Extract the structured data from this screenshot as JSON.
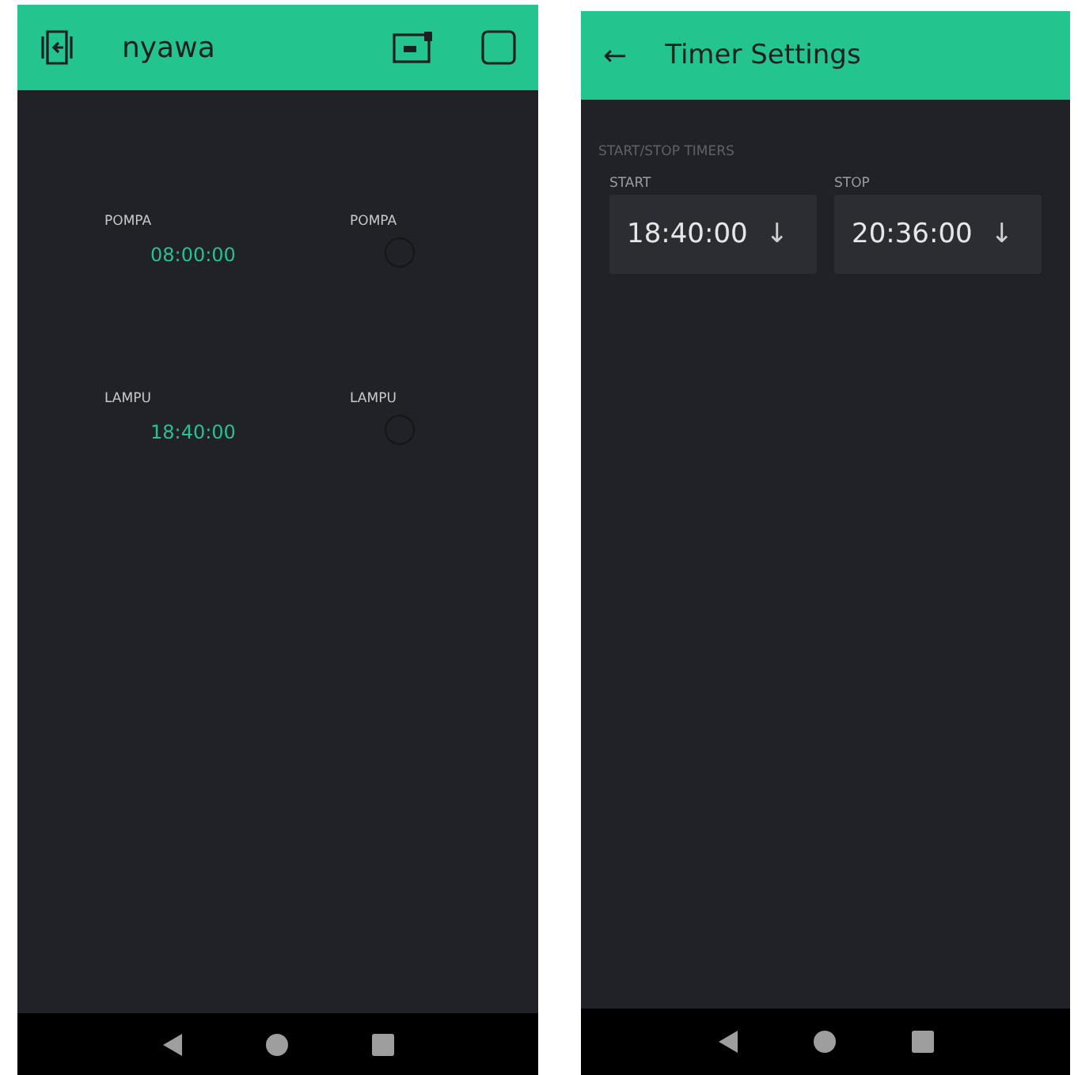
{
  "dashboard": {
    "title": "nyawa",
    "widgets": [
      {
        "timer_label": "POMPA",
        "timer_value": "08:00:00",
        "led_label": "POMPA",
        "led_on": false
      },
      {
        "timer_label": "LAMPU",
        "timer_value": "18:40:00",
        "led_label": "LAMPU",
        "led_on": false
      }
    ]
  },
  "timer_settings": {
    "title": "Timer Settings",
    "back_icon": "←",
    "section": "START/STOP TIMERS",
    "fields": [
      {
        "label": "START",
        "value": "18:40:00",
        "arrow": "↓"
      },
      {
        "label": "STOP",
        "value": "20:36:00",
        "arrow": "↓"
      }
    ]
  }
}
